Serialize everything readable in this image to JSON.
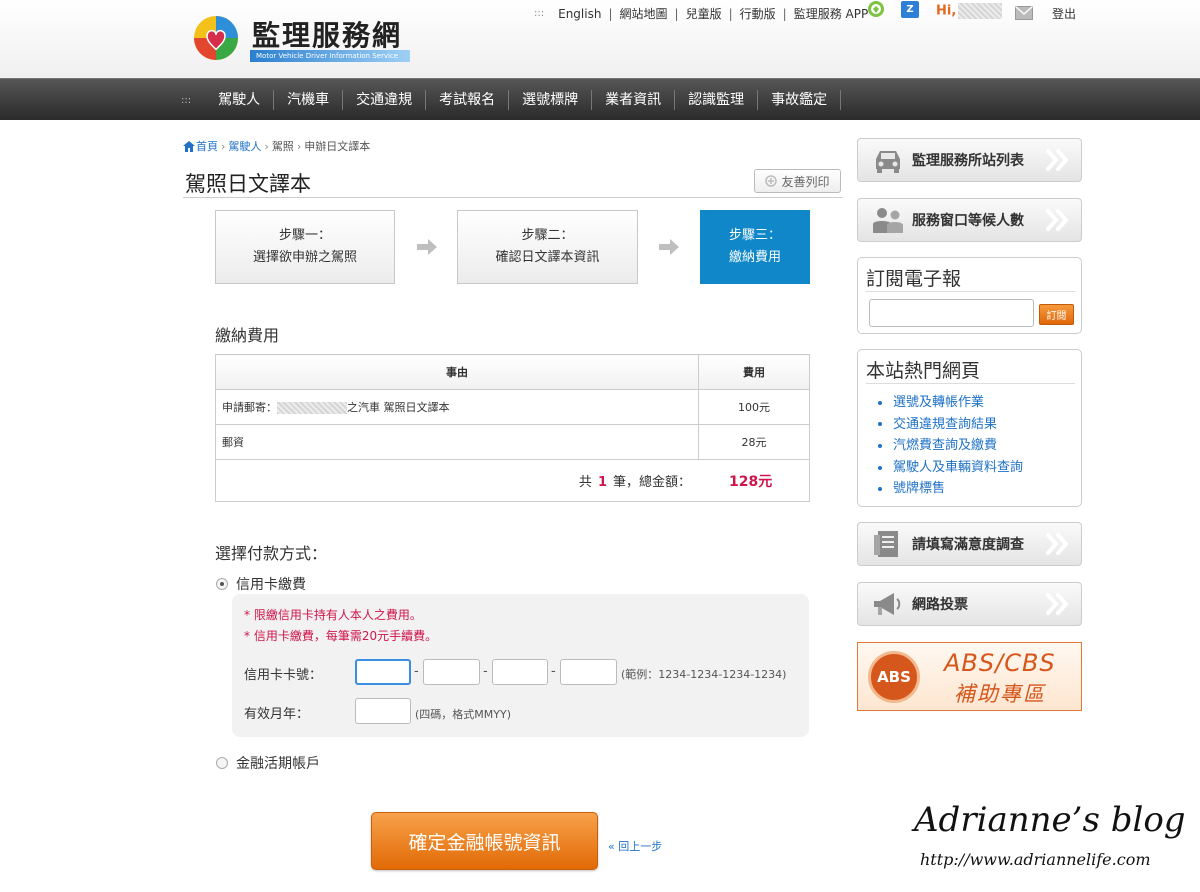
{
  "header": {
    "logo_title": "監理服務網",
    "logo_subtitle": "Motor Vehicle Driver Information Service",
    "top_links": [
      "English",
      "網站地圖",
      "兒童版",
      "行動版",
      "監理服務 APP"
    ],
    "greeting": "Hi,",
    "logout": "登出",
    "icons": [
      "green-app-icon",
      "blue-z-icon",
      "mail-icon"
    ]
  },
  "nav": {
    "items": [
      "駕駛人",
      "汽機車",
      "交通違規",
      "考試報名",
      "選號標牌",
      "業者資訊",
      "認識監理",
      "事故鑑定"
    ]
  },
  "breadcrumb": {
    "home": "首頁",
    "level1": "駕駛人",
    "level2": "駕照",
    "current": "申辦日文譯本"
  },
  "page": {
    "title": "駕照日文譯本",
    "print_label": "友善列印"
  },
  "steps": [
    {
      "line1": "步驟一：",
      "line2": "選擇欲申辦之駕照",
      "active": false
    },
    {
      "line1": "步驟二：",
      "line2": "確認日文譯本資訊",
      "active": false
    },
    {
      "line1": "步驟三：",
      "line2": "繳納費用",
      "active": true
    }
  ],
  "fee": {
    "section_title": "繳納費用",
    "col_reason": "事由",
    "col_fee": "費用",
    "rows": [
      {
        "reason_prefix": "申請郵寄：",
        "reason_suffix": "之汽車 駕照日文譯本",
        "amount": "100元"
      },
      {
        "reason_prefix": "郵資",
        "reason_suffix": "",
        "amount": "28元"
      }
    ],
    "total_prefix": "共",
    "total_count": "1",
    "total_suffix": "筆，總金額：",
    "total_amount": "128元"
  },
  "payment": {
    "section_title": "選擇付款方式：",
    "option_card": "信用卡繳費",
    "option_card_checked": true,
    "notes": [
      "* 限繳信用卡持有人本人之費用。",
      "* 信用卡繳費，每筆需20元手續費。"
    ],
    "card_number_label": "信用卡卡號：",
    "card_number_hint": "(範例：1234-1234-1234-1234)",
    "card_number_values": [
      "",
      "",
      "",
      ""
    ],
    "expiry_label": "有效月年：",
    "expiry_hint": "(四碼，格式MMYY)",
    "expiry_value": "",
    "option_bank": "金融活期帳戶",
    "option_bank_checked": false,
    "dash": "-"
  },
  "actions": {
    "submit": "確定金融帳號資訊",
    "back": "« 回上一步"
  },
  "sidebar": {
    "stations": "監理服務所站列表",
    "queue": "服務窗口等候人數",
    "newsletter_title": "訂閱電子報",
    "subscribe": "訂閱",
    "newsletter_value": "",
    "hot_title": "本站熱門網頁",
    "hot_links": [
      "選號及轉帳作業",
      "交通違規查詢結果",
      "汽燃費查詢及繳費",
      "駕駛人及車輛資料查詢",
      "號牌標售"
    ],
    "survey": "請填寫滿意度調查",
    "vote": "網路投票",
    "abs_circle": "ABS",
    "abs_title": "ABS/CBS",
    "abs_sub": "補助專區"
  },
  "watermark": {
    "title": "Adrianne’s blog",
    "url": "http://www.adriannelife.com"
  },
  "colors": {
    "accent_blue": "#0f87c9",
    "link_blue": "#1f72c7",
    "alert_red": "#d0154c",
    "orange": "#e26a06",
    "nav_dark": "#2a2a2a"
  }
}
